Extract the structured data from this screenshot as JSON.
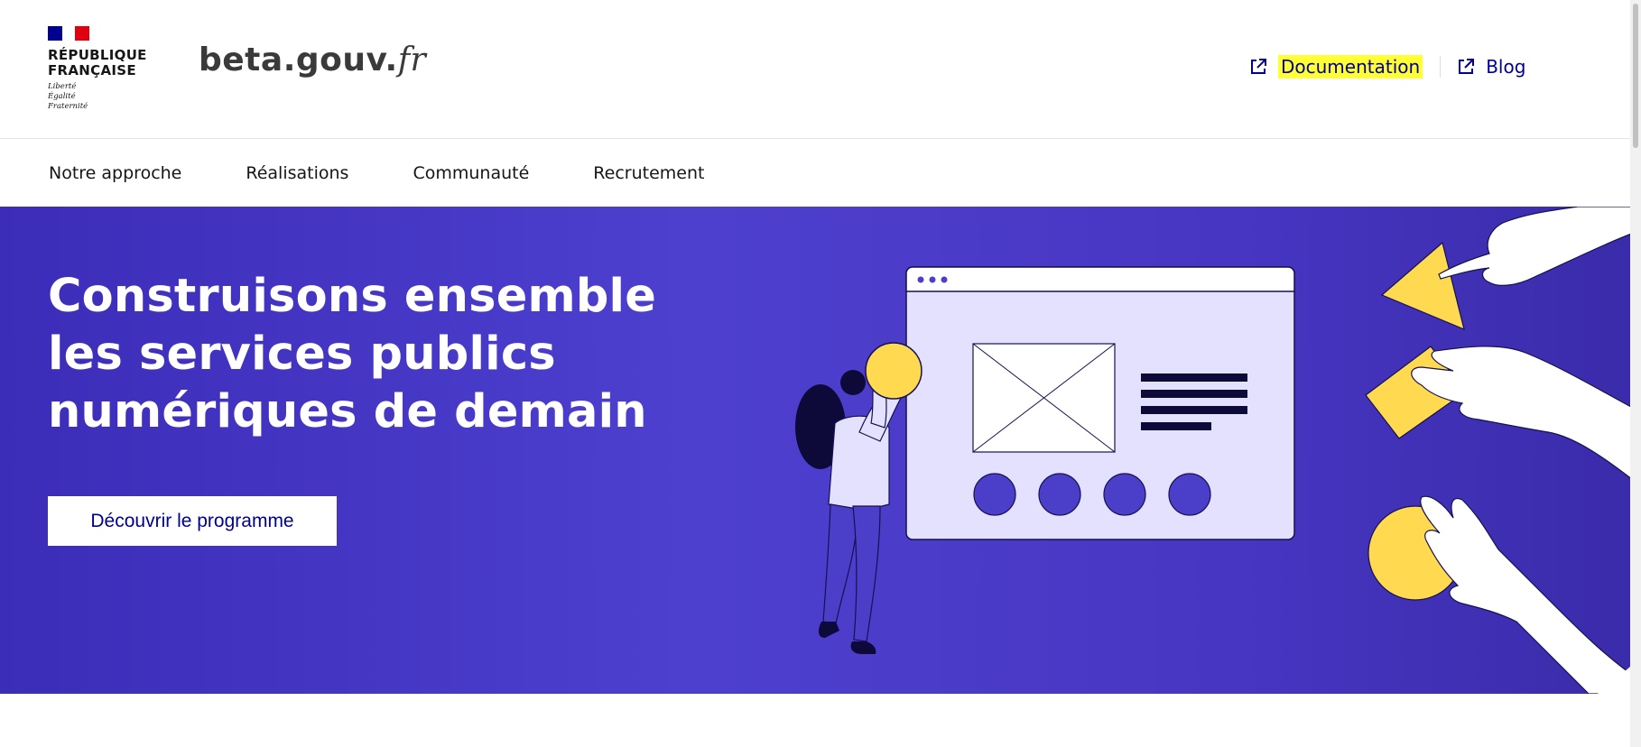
{
  "brand": {
    "republic_name": "RÉPUBLIQUE\nFRANÇAISE",
    "motto": "Liberté\nÉgalité\nFraternité",
    "site_name_main": "beta.gouv.",
    "site_name_suffix": "fr"
  },
  "tools": {
    "documentation_label": "Documentation",
    "blog_label": "Blog",
    "highlight_color": "#ffff33",
    "link_icon": "external-link-icon"
  },
  "nav": {
    "items": [
      "Notre approche",
      "Réalisations",
      "Communauté",
      "Recrutement"
    ]
  },
  "hero": {
    "title": "Construisons ensemble les services publics numériques de demain",
    "cta_label": "Découvrir le programme",
    "background_color": "#4a3cc9",
    "accent_yellow": "#ffd94f",
    "illustration": "person-assembling-web-page-illustration"
  }
}
